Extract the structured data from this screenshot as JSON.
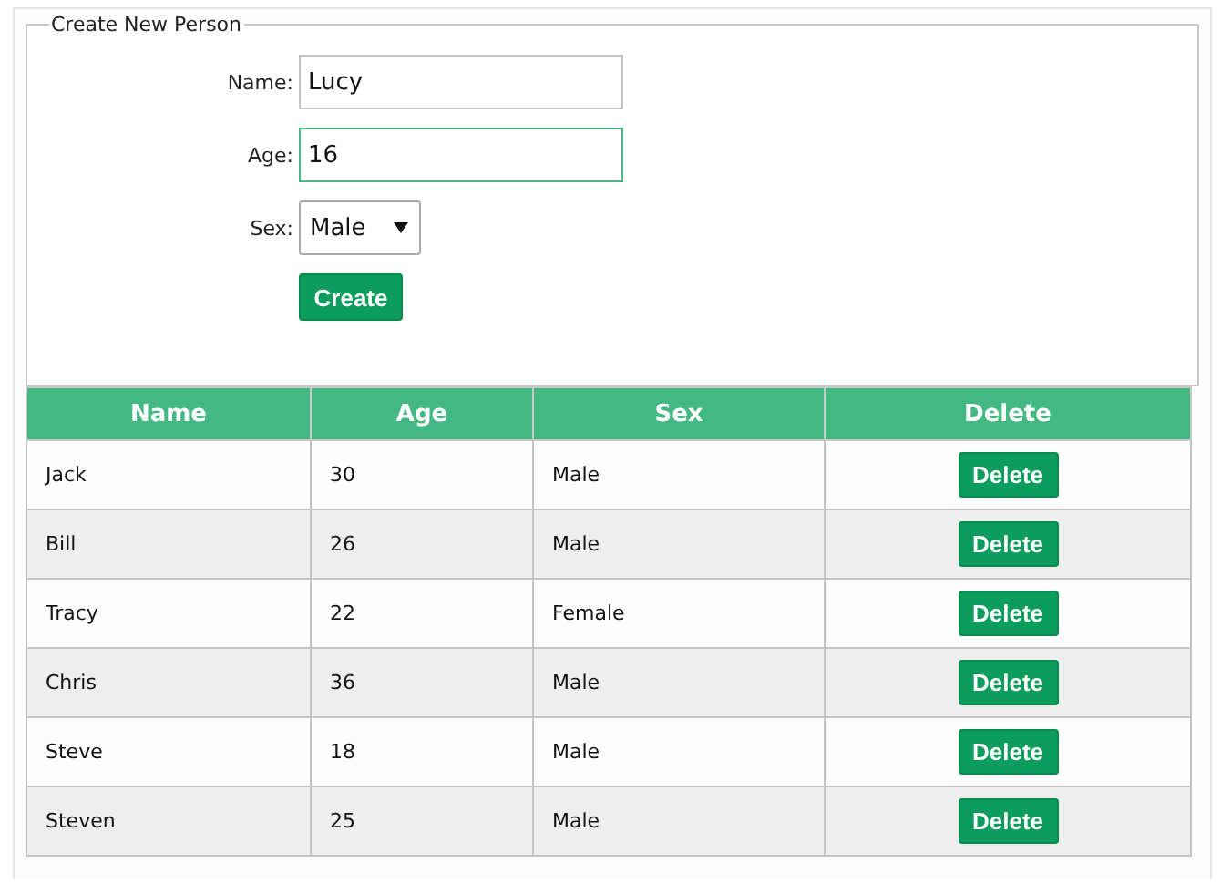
{
  "form": {
    "legend": "Create New Person",
    "fields": [
      {
        "kind": "text",
        "label": "Name:",
        "value": "Lucy",
        "focused": false
      },
      {
        "kind": "text",
        "label": "Age:",
        "value": "16",
        "focused": true
      },
      {
        "kind": "select",
        "label": "Sex:",
        "value": "Male",
        "focused": false
      }
    ],
    "submit": "Create"
  },
  "table": {
    "columns": [
      "Name",
      "Age",
      "Sex",
      "Delete"
    ],
    "rows": [
      {
        "cells": [
          "Jack",
          "30",
          "Male"
        ],
        "action": "Delete"
      },
      {
        "cells": [
          "Bill",
          "26",
          "Male"
        ],
        "action": "Delete"
      },
      {
        "cells": [
          "Tracy",
          "22",
          "Female"
        ],
        "action": "Delete"
      },
      {
        "cells": [
          "Chris",
          "36",
          "Male"
        ],
        "action": "Delete"
      },
      {
        "cells": [
          "Steve",
          "18",
          "Male"
        ],
        "action": "Delete"
      },
      {
        "cells": [
          "Steven",
          "25",
          "Male"
        ],
        "action": "Delete"
      }
    ]
  }
}
